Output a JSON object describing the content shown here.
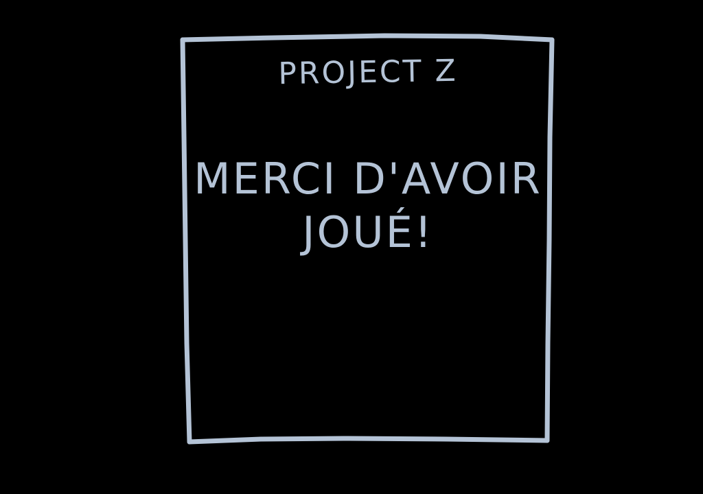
{
  "screen": {
    "title": "PROJECT Z",
    "message_line1": "MERCI D'AVOIR",
    "message_line2": "JOUÉ!"
  },
  "colors": {
    "background": "#000000",
    "ink": "#b4c3d6"
  }
}
